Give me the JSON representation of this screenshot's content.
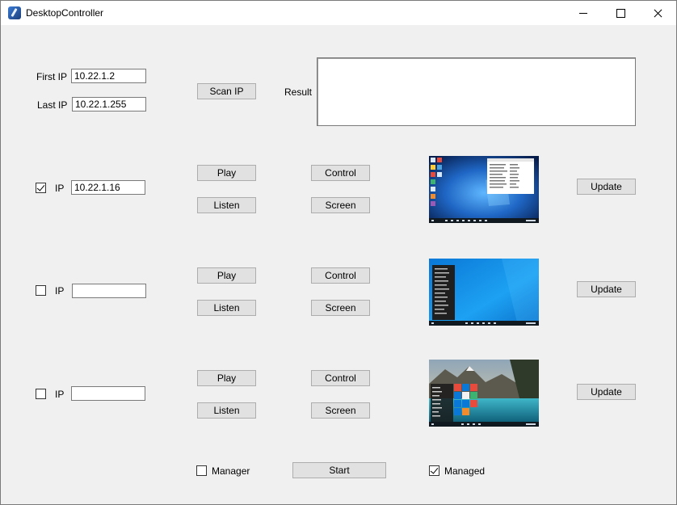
{
  "window": {
    "title": "DesktopController"
  },
  "scan": {
    "first_ip_label": "First IP",
    "first_ip_value": "10.22.1.2",
    "last_ip_label": "Last IP",
    "last_ip_value": "10.22.1.255",
    "scan_button": "Scan IP",
    "result_label": "Result",
    "result_value": ""
  },
  "clients": [
    {
      "checked": true,
      "ip_label": "IP",
      "ip_value": "10.22.1.16",
      "play": "Play",
      "listen": "Listen",
      "control": "Control",
      "screen": "Screen",
      "update": "Update"
    },
    {
      "checked": false,
      "ip_label": "IP",
      "ip_value": "",
      "play": "Play",
      "listen": "Listen",
      "control": "Control",
      "screen": "Screen",
      "update": "Update"
    },
    {
      "checked": false,
      "ip_label": "IP",
      "ip_value": "",
      "play": "Play",
      "listen": "Listen",
      "control": "Control",
      "screen": "Screen",
      "update": "Update"
    }
  ],
  "footer": {
    "manager_label": "Manager",
    "manager_checked": false,
    "start_button": "Start",
    "managed_label": "Managed",
    "managed_checked": true
  }
}
